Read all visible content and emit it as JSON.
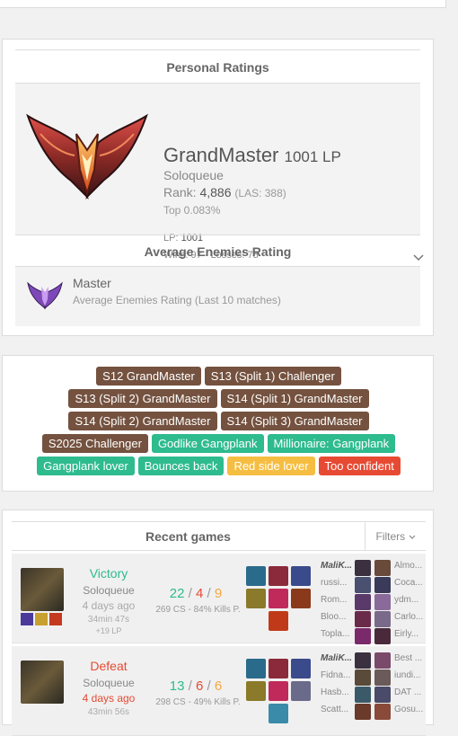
{
  "personal": {
    "title": "Personal Ratings",
    "tier": "GrandMaster",
    "lp_short": "1001 LP",
    "queue": "Soloqueue",
    "rank_label": "Rank:",
    "rank_value": "4,886",
    "rank_las": "(LAS: 388)",
    "top": "Top 0.083%",
    "lp_label": "LP:",
    "lp_value": "1001",
    "wins_losses": "Wins: 97 - Losses: 75"
  },
  "average": {
    "title": "Average Enemies Rating",
    "tier": "Master",
    "desc": "Average Enemies Rating (Last 10 matches)"
  },
  "tags": [
    [
      {
        "label": "S12 GrandMaster",
        "color": "brown"
      },
      {
        "label": "S13 (Split 1) Challenger",
        "color": "brown"
      }
    ],
    [
      {
        "label": "S13 (Split 2) GrandMaster",
        "color": "brown"
      },
      {
        "label": "S14 (Split 1) GrandMaster",
        "color": "brown"
      }
    ],
    [
      {
        "label": "S14 (Split 2) GrandMaster",
        "color": "brown"
      },
      {
        "label": "S14 (Split 3) GrandMaster",
        "color": "brown"
      }
    ],
    [
      {
        "label": "S2025 Challenger",
        "color": "brown"
      },
      {
        "label": "Godlike Gangplank",
        "color": "green"
      },
      {
        "label": "Millionaire: Gangplank",
        "color": "green"
      }
    ],
    [
      {
        "label": "Gangplank lover",
        "color": "green"
      },
      {
        "label": "Bounces back",
        "color": "green"
      },
      {
        "label": "Red side lover",
        "color": "orange"
      },
      {
        "label": "Too confident",
        "color": "red"
      }
    ]
  ],
  "recent": {
    "title": "Recent games",
    "filters": "Filters",
    "games": [
      {
        "result": "Victory",
        "queue": "Soloqueue",
        "ago": "4 days ago",
        "duration": "34min 47s",
        "lp": "+19 LP",
        "kills": "22",
        "deaths": "4",
        "assists": "9",
        "cs": "269 CS - 84% Kills P.",
        "team": [
          "MaliK...",
          "russi...",
          "Rom...",
          "Bloo...",
          "Topla..."
        ],
        "enemy": [
          "Almo...",
          "Coca...",
          "ydm...",
          "Carlo...",
          "Eirly..."
        ]
      },
      {
        "result": "Defeat",
        "queue": "Soloqueue",
        "ago": "4 days ago",
        "duration": "43min 56s",
        "lp": "",
        "kills": "13",
        "deaths": "6",
        "assists": "6",
        "cs": "298 CS - 49% Kills P.",
        "team": [
          "MaliK...",
          "Fidna...",
          "Hasb...",
          "Scatt...",
          ""
        ],
        "enemy": [
          "Best ...",
          "iundi...",
          "DAT ...",
          "Gosu...",
          ""
        ]
      }
    ]
  },
  "colors": {
    "win": "#2ebb8e",
    "loss": "#e74a33",
    "tag_brown": "#74523f",
    "tag_green": "#2ebb8e",
    "tag_orange": "#f5be42",
    "tag_red": "#e74a33"
  }
}
